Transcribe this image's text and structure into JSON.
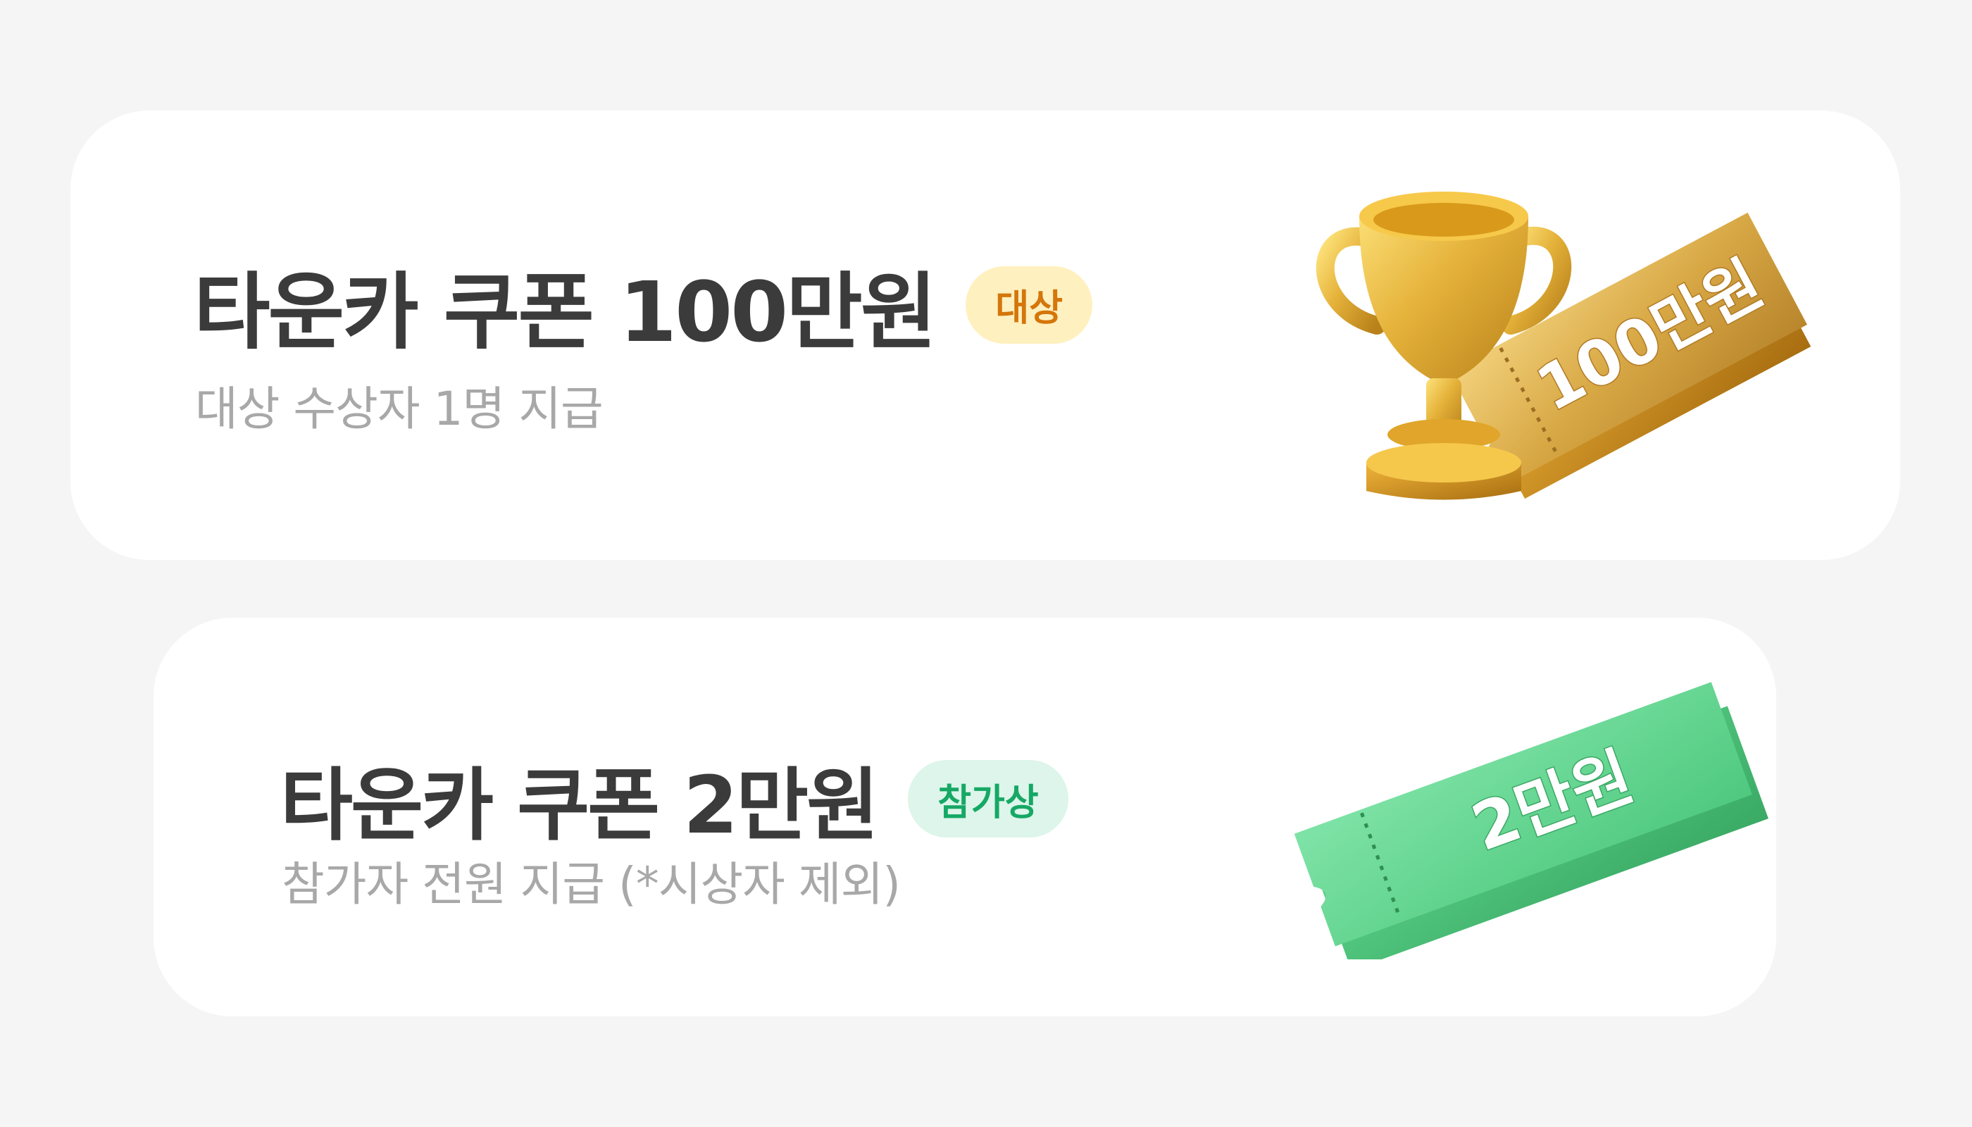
{
  "grand_prize": {
    "title": "타운카 쿠폰 100만원",
    "badge": "대상",
    "subtitle": "대상 수상자 1명 지급",
    "ticket_text": "100만원",
    "colors": {
      "badge_bg": "#fff0bf",
      "badge_text": "#d4760a",
      "ticket": "#d9a72f",
      "trophy": "#f2b71c"
    },
    "icons": [
      "trophy-icon",
      "gold-ticket-icon"
    ]
  },
  "participation_prize": {
    "title": "타운카 쿠폰 2만원",
    "badge": "참가상",
    "subtitle": "참가자 전원 지급 (*시상자 제외)",
    "ticket_text": "2만원",
    "colors": {
      "badge_bg": "#ddf5ea",
      "badge_text": "#16a865",
      "ticket": "#5fd68f"
    },
    "icons": [
      "green-ticket-icon"
    ]
  }
}
